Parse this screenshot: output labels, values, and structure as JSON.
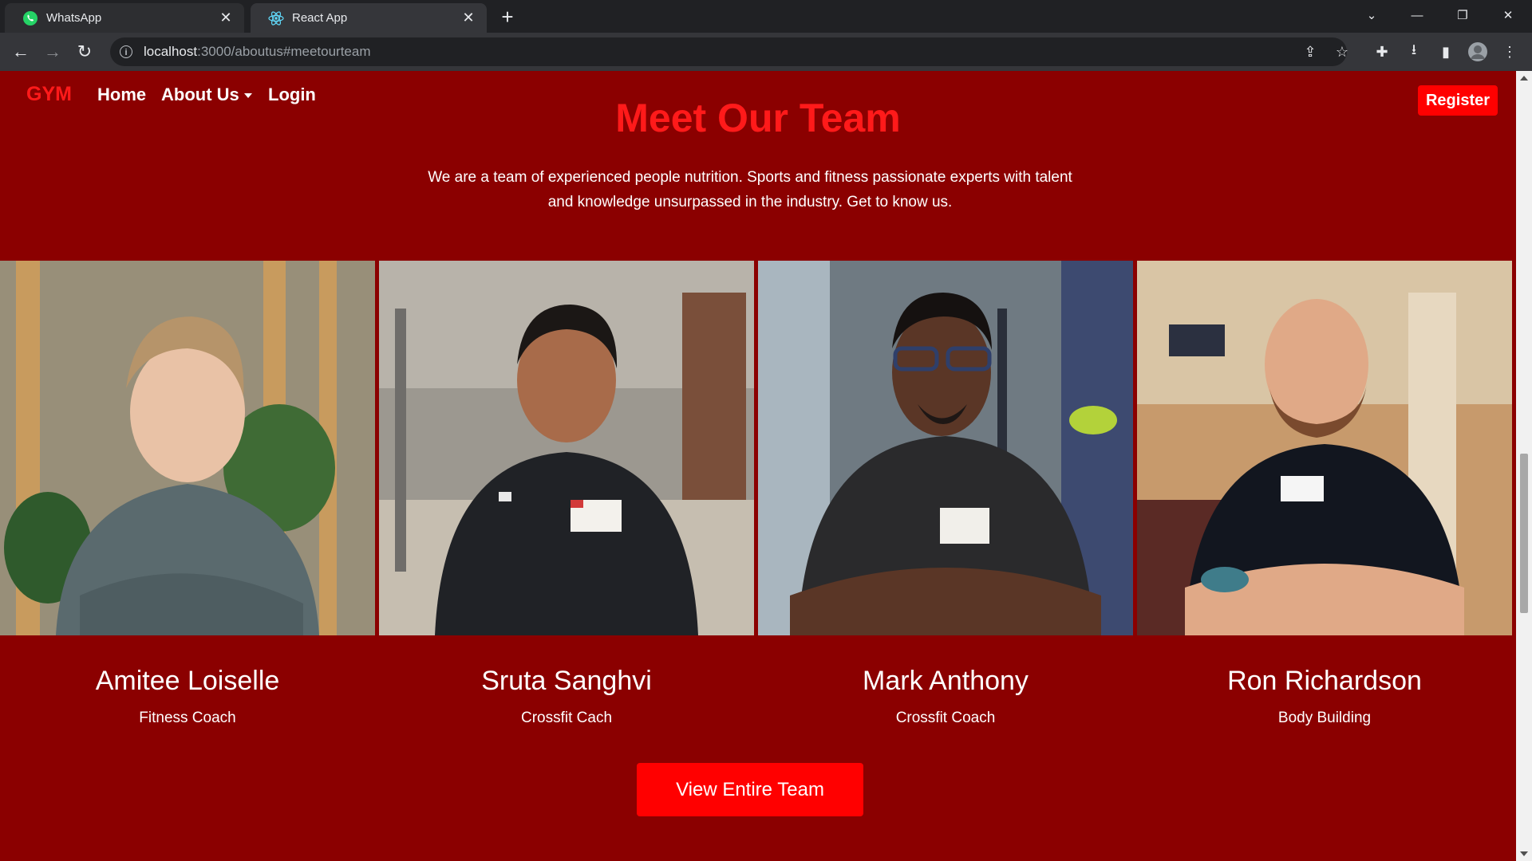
{
  "browser": {
    "tabs": [
      {
        "title": "WhatsApp",
        "active": false
      },
      {
        "title": "React App",
        "active": true
      }
    ],
    "url_host": "localhost",
    "url_path": ":3000/aboutus#meetourteam"
  },
  "nav": {
    "brand": "GYM",
    "links": [
      "Home",
      "About Us",
      "Login"
    ],
    "register": "Register"
  },
  "section": {
    "title": "Meet Our Team",
    "intro_line1": "We are a team of experienced people nutrition. Sports and fitness passionate experts with talent",
    "intro_line2": "and knowledge unsurpassed in the industry. Get to know us."
  },
  "team": [
    {
      "name": "Amitee Loiselle",
      "role": "Fitness Coach"
    },
    {
      "name": "Sruta Sanghvi",
      "role": "Crossfit Cach"
    },
    {
      "name": "Mark Anthony",
      "role": "Crossfit Coach"
    },
    {
      "name": "Ron Richardson",
      "role": "Body Building"
    }
  ],
  "cta": "View Entire Team"
}
